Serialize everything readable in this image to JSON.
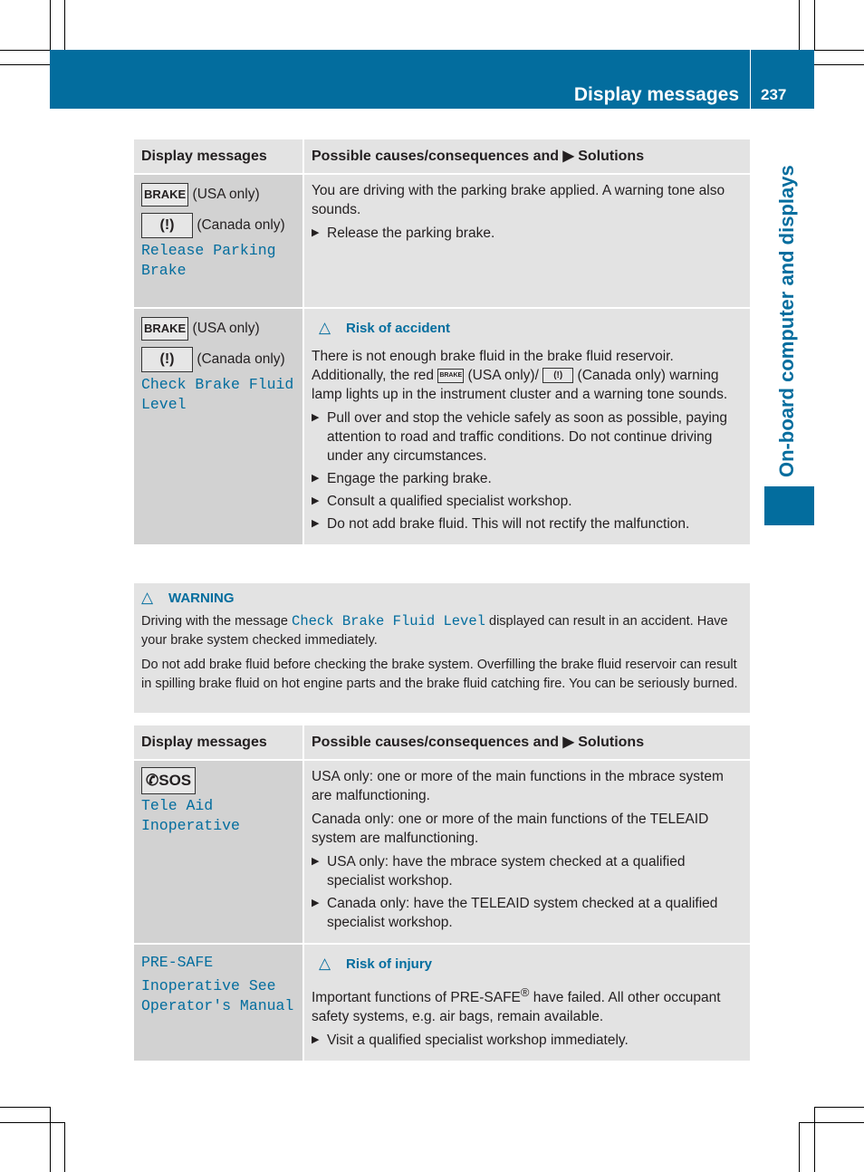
{
  "header": {
    "section_title": "Display messages",
    "page_number": "237"
  },
  "side_tab": {
    "title": "On-board computer and displays"
  },
  "table1": {
    "headers": [
      "Display messages",
      "Possible causes/consequences and ▶ Solutions"
    ],
    "rows": [
      {
        "icons": {
          "usa": "BRAKE",
          "usa_label": "(USA only)",
          "canada": "(!)",
          "canada_label": "(Canada only)"
        },
        "message": [
          "Release Parking",
          "Brake"
        ],
        "description": "You are driving with the parking brake applied. A warning tone also sounds.",
        "solutions": [
          "Release the parking brake."
        ]
      },
      {
        "icons": {
          "usa": "BRAKE",
          "usa_label": "(USA only)",
          "canada": "(!)",
          "canada_label": "(Canada only)"
        },
        "message": [
          "Check Brake Fluid",
          "Level"
        ],
        "risk": "Risk of accident",
        "description_parts": [
          "There is not enough brake fluid in the brake fluid reservoir. Additionally, the red",
          "(USA only)/",
          "(Canada only) warning lamp lights up in the instrument cluster and a warning tone sounds."
        ],
        "solutions": [
          "Pull over and stop the vehicle safely as soon as possible, paying attention to road and traffic conditions. Do not continue driving under any circumstances.",
          "Engage the parking brake.",
          "Consult a qualified specialist workshop.",
          "Do not add brake fluid. This will not rectify the malfunction."
        ]
      }
    ]
  },
  "warning": {
    "title": "WARNING",
    "p1_before": "Driving with the message",
    "p1_code": "Check Brake Fluid Level",
    "p1_after": "displayed can result in an accident. Have your brake system checked immediately.",
    "p2": "Do not add brake fluid before checking the brake system. Overfilling the brake fluid reservoir can result in spilling brake fluid on hot engine parts and the brake fluid catching fire. You can be seriously burned."
  },
  "table2": {
    "headers": [
      "Display messages",
      "Possible causes/consequences and ▶ Solutions"
    ],
    "rows": [
      {
        "icon": "SOS",
        "message": [
          "Tele Aid",
          "Inoperative"
        ],
        "paragraphs": [
          "USA only: one or more of the main functions in the mbrace system are malfunctioning.",
          "Canada only: one or more of the main functions of the TELEAID system are malfunctioning."
        ],
        "solutions": [
          "USA only: have the mbrace system checked at a qualified specialist workshop.",
          "Canada only: have the TELEAID system checked at a qualified specialist workshop."
        ]
      },
      {
        "message": [
          "PRE-SAFE",
          "Inoperative See",
          "Operator's Manual"
        ],
        "risk": "Risk of injury",
        "description_before": "Important functions of PRE-SAFE",
        "description_sup": "®",
        "description_after": " have failed. All other occupant safety systems, e.g. air bags, remain available.",
        "solutions": [
          "Visit a qualified specialist workshop immediately."
        ]
      }
    ]
  }
}
